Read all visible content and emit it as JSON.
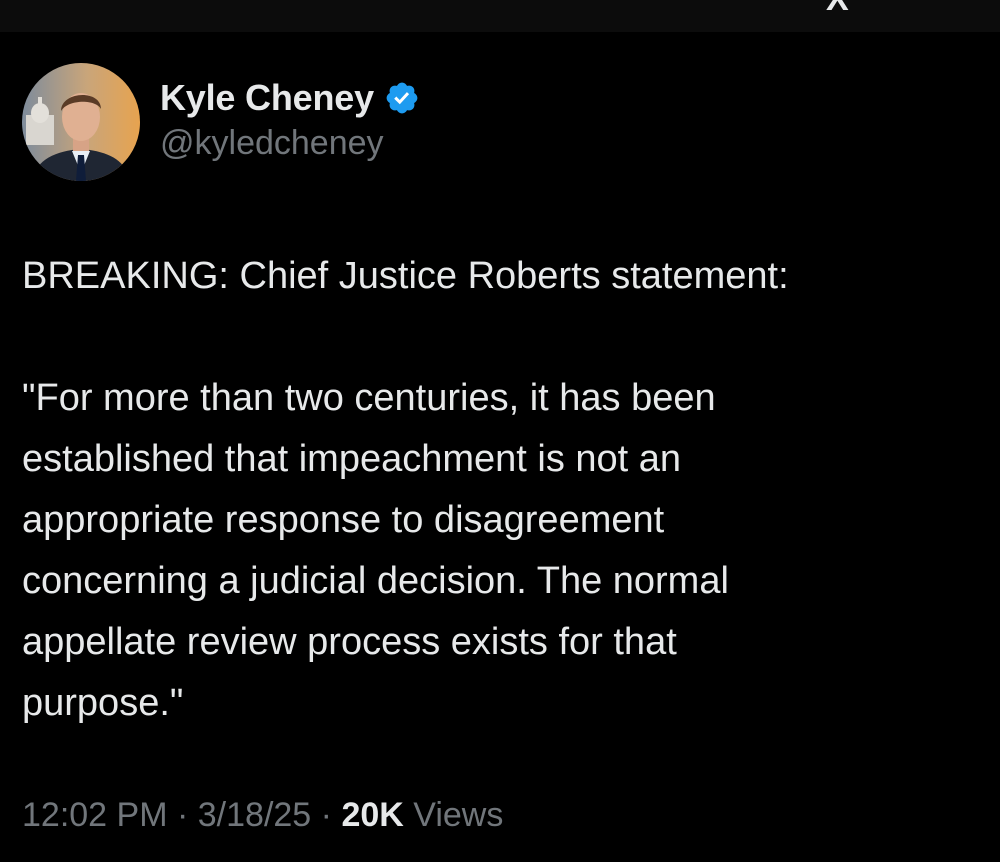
{
  "header": {
    "logo_icon": "x-logo-icon"
  },
  "author": {
    "display_name": "Kyle Cheney",
    "handle": "@kyledcheney",
    "verified": true,
    "verified_color": "#1d9bf0",
    "avatar_icon": "profile-photo"
  },
  "tweet": {
    "lines": [
      "BREAKING: Chief Justice Roberts statement:",
      "",
      "\"For more than two centuries, it has been",
      "established that impeachment is not an",
      "appropriate response to disagreement",
      "concerning a judicial decision. The normal",
      "appellate review process exists for that",
      "purpose.\""
    ]
  },
  "meta": {
    "time": "12:02 PM",
    "separator": "·",
    "date": "3/18/25",
    "views_count": "20K",
    "views_label": "Views"
  },
  "colors": {
    "background": "#000000",
    "text_primary": "#e7e9ea",
    "text_secondary": "#71767b"
  }
}
